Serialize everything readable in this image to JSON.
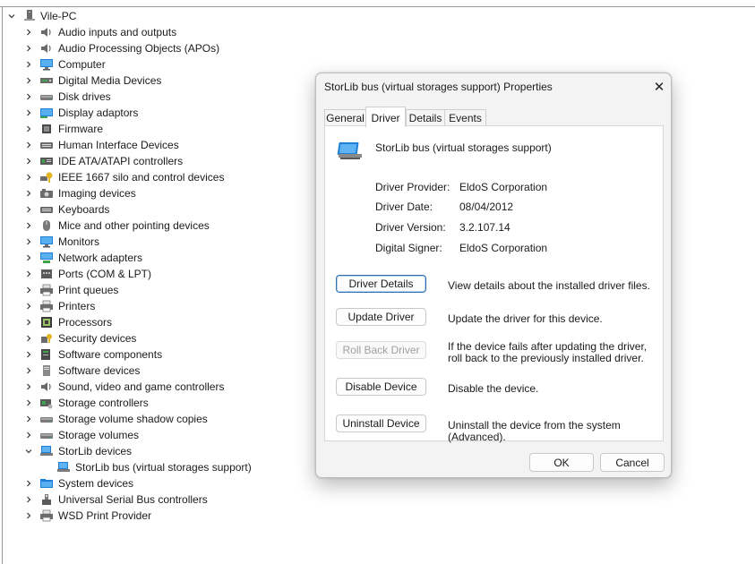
{
  "tree": {
    "root": "Vile-PC",
    "categories": [
      {
        "label": "Audio inputs and outputs",
        "icon": "speaker-icon"
      },
      {
        "label": "Audio Processing Objects (APOs)",
        "icon": "speaker-icon"
      },
      {
        "label": "Computer",
        "icon": "monitor-icon"
      },
      {
        "label": "Digital Media Devices",
        "icon": "media-device-icon"
      },
      {
        "label": "Disk drives",
        "icon": "disk-drive-icon"
      },
      {
        "label": "Display adaptors",
        "icon": "display-adapter-icon"
      },
      {
        "label": "Firmware",
        "icon": "chip-icon"
      },
      {
        "label": "Human Interface Devices",
        "icon": "keyboard-icon"
      },
      {
        "label": "IDE ATA/ATAPI controllers",
        "icon": "ide-controller-icon"
      },
      {
        "label": "IEEE 1667 silo and control devices",
        "icon": "key-icon"
      },
      {
        "label": "Imaging devices",
        "icon": "camera-icon"
      },
      {
        "label": "Keyboards",
        "icon": "keyboard-icon"
      },
      {
        "label": "Mice and other pointing devices",
        "icon": "mouse-icon"
      },
      {
        "label": "Monitors",
        "icon": "monitor-icon"
      },
      {
        "label": "Network adapters",
        "icon": "network-icon"
      },
      {
        "label": "Ports (COM & LPT)",
        "icon": "port-icon"
      },
      {
        "label": "Print queues",
        "icon": "printer-icon"
      },
      {
        "label": "Printers",
        "icon": "printer-icon"
      },
      {
        "label": "Processors",
        "icon": "processor-icon"
      },
      {
        "label": "Security devices",
        "icon": "security-key-icon"
      },
      {
        "label": "Software components",
        "icon": "software-component-icon"
      },
      {
        "label": "Software devices",
        "icon": "software-device-icon"
      },
      {
        "label": "Sound, video and game controllers",
        "icon": "speaker-icon"
      },
      {
        "label": "Storage controllers",
        "icon": "storage-controller-icon"
      },
      {
        "label": "Storage volume shadow copies",
        "icon": "disk-drive-icon"
      },
      {
        "label": "Storage volumes",
        "icon": "disk-drive-icon"
      },
      {
        "label": "StorLib devices",
        "icon": "storlib-icon",
        "expanded": true
      },
      {
        "label": "StorLib bus (virtual storages support)",
        "icon": "storlib-icon",
        "child": true
      },
      {
        "label": "System devices",
        "icon": "folder-icon"
      },
      {
        "label": "Universal Serial Bus controllers",
        "icon": "usb-icon"
      },
      {
        "label": "WSD Print Provider",
        "icon": "printer-icon"
      }
    ]
  },
  "dialog": {
    "title": "StorLib bus (virtual storages support) Properties",
    "close_glyph": "✕",
    "tabs": [
      "General",
      "Driver",
      "Details",
      "Events"
    ],
    "active_tab": "Driver",
    "device_name": "StorLib bus (virtual storages support)",
    "driver_info": [
      {
        "label": "Driver Provider:",
        "value": "EldoS Corporation"
      },
      {
        "label": "Driver Date:",
        "value": "08/04/2012"
      },
      {
        "label": "Driver Version:",
        "value": "3.2.107.14"
      },
      {
        "label": "Digital Signer:",
        "value": "EldoS Corporation"
      }
    ],
    "actions": [
      {
        "label": "Driver Details",
        "desc": "View details about the installed driver files.",
        "state": "focused"
      },
      {
        "label": "Update Driver",
        "desc": "Update the driver for this device.",
        "state": "normal"
      },
      {
        "label": "Roll Back Driver",
        "desc": "If the device fails after updating the driver, roll back to the previously installed driver.",
        "state": "disabled"
      },
      {
        "label": "Disable Device",
        "desc": "Disable the device.",
        "state": "normal"
      },
      {
        "label": "Uninstall Device",
        "desc": "Uninstall the device from the system (Advanced).",
        "state": "normal"
      }
    ],
    "ok_label": "OK",
    "cancel_label": "Cancel"
  },
  "colors": {
    "accent": "#2f6fb1",
    "icon_blue": "#1f7fd6",
    "icon_gray": "#6b6b6b"
  }
}
